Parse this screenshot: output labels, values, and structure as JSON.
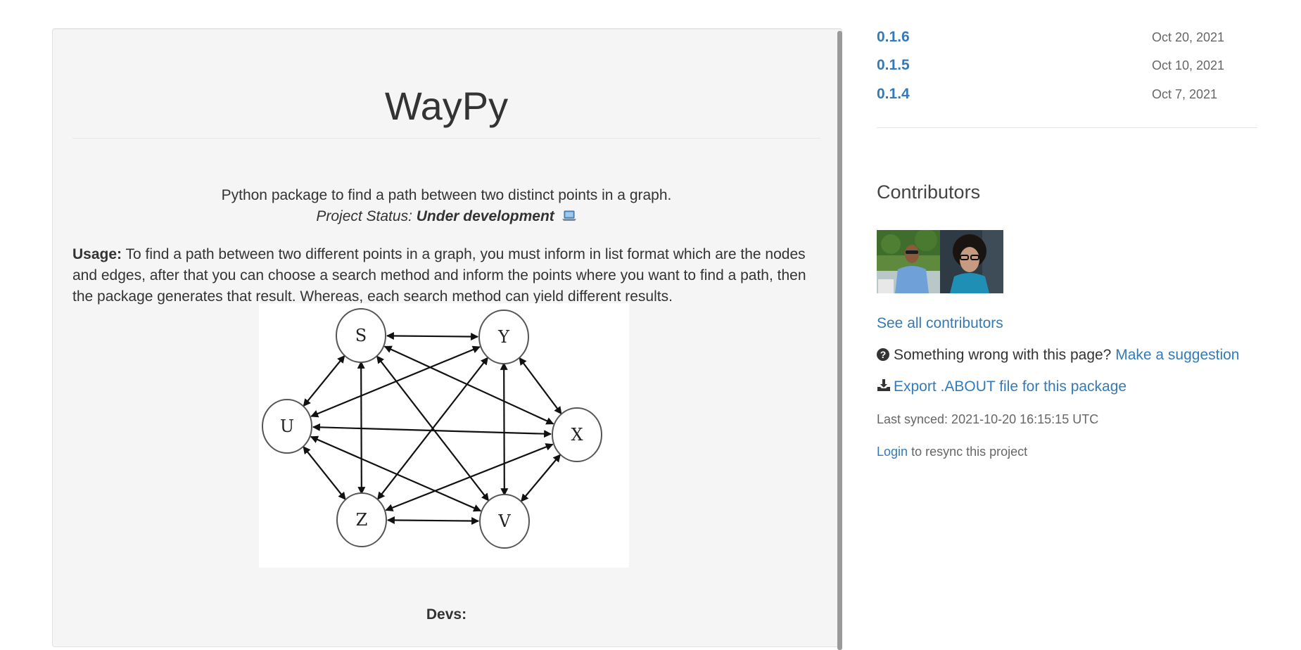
{
  "releases": [
    {
      "version": "0.1.6",
      "date": "Oct 20, 2021"
    },
    {
      "version": "0.1.5",
      "date": "Oct 10, 2021"
    },
    {
      "version": "0.1.4",
      "date": "Oct 7, 2021"
    }
  ],
  "readme": {
    "title": "WayPy",
    "tagline": "Python package to find a path between two distinct points in a graph.",
    "status_prefix": "Project Status:",
    "status_value": "Under development",
    "usage_label": "Usage:",
    "usage_text": "To find a path between two different points in a graph, you must inform in list format which are the nodes and edges, after that you can choose a search method and inform the points where you want to find a path, then the package generates that result. Whereas, each search method can yield different results.",
    "graph_nodes": [
      "S",
      "Y",
      "U",
      "X",
      "Z",
      "V"
    ],
    "devs_label": "Devs:"
  },
  "sidebar": {
    "contributors_heading": "Contributors",
    "see_all": "See all contributors",
    "wrong_text": "Something wrong with this page?",
    "suggestion_link": "Make a suggestion",
    "export_link": "Export .ABOUT file for this package",
    "last_synced": "Last synced: 2021-10-20 16:15:15 UTC",
    "login_link": "Login",
    "resync_text": "to resync this project"
  },
  "colors": {
    "link": "#337ab7",
    "panel_bg": "#f5f5f5",
    "text": "#333333",
    "muted": "#666666"
  }
}
